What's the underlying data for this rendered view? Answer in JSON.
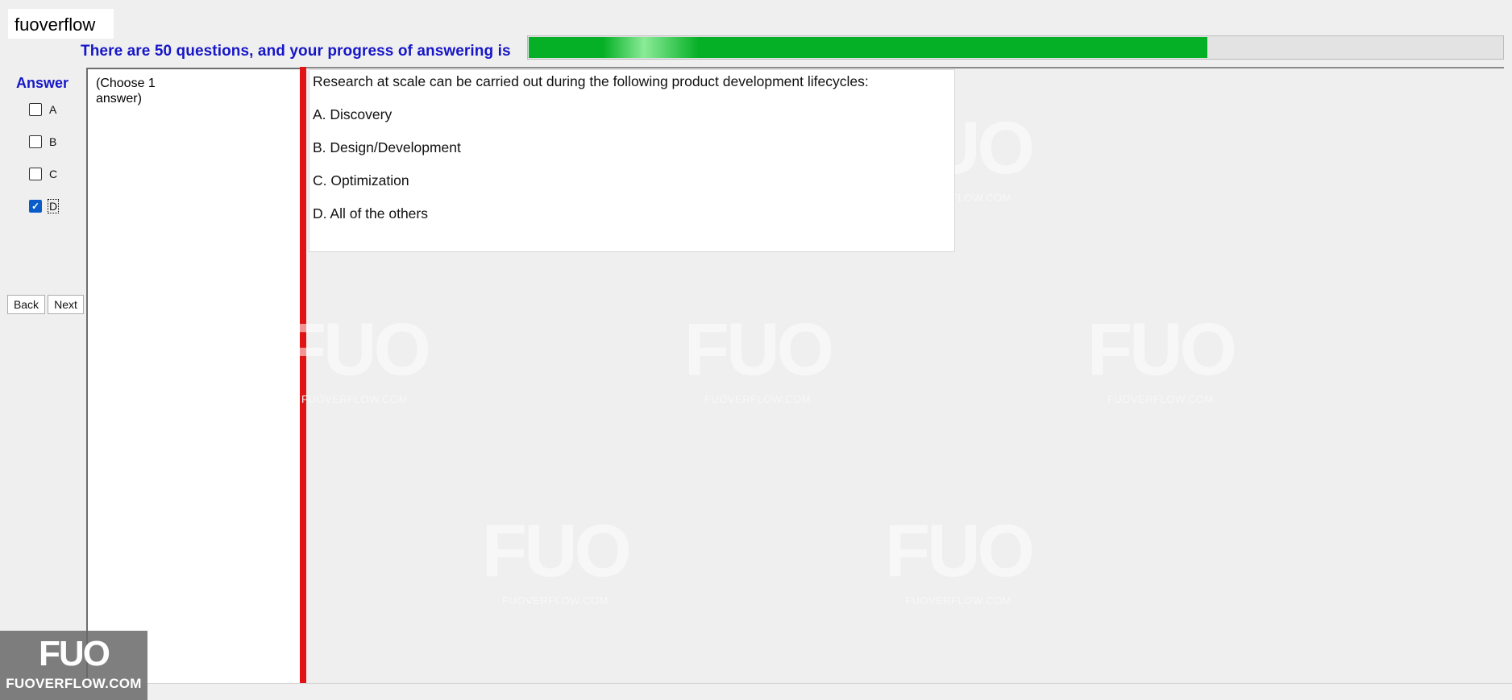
{
  "app": {
    "title": "fuoverflow"
  },
  "progress": {
    "label": "There are 50 questions, and your progress of answering is",
    "fraction": 0.696,
    "color": "#06b026"
  },
  "answer_panel": {
    "title": "Answer",
    "options": [
      {
        "letter": "A",
        "checked": false
      },
      {
        "letter": "B",
        "checked": false
      },
      {
        "letter": "C",
        "checked": false
      },
      {
        "letter": "D",
        "checked": true
      }
    ]
  },
  "nav": {
    "back_label": "Back",
    "next_label": "Next"
  },
  "instruction": "(Choose 1 answer)",
  "question": {
    "text": "Research at scale can be carried out during the following product development lifecycles:",
    "options": [
      "A.  Discovery",
      "B.  Design/Development",
      "C.  Optimization",
      "D.  All of the others"
    ]
  },
  "watermark": {
    "mark": "FUO",
    "site": "FUOVERFLOW.COM"
  },
  "corner_logo": {
    "mark": "FUO",
    "site": "FUOVERFLOW.COM"
  },
  "colors": {
    "accent_text": "#1616c8",
    "red_divider": "#e01414",
    "checkbox_checked": "#0a5cc9"
  }
}
